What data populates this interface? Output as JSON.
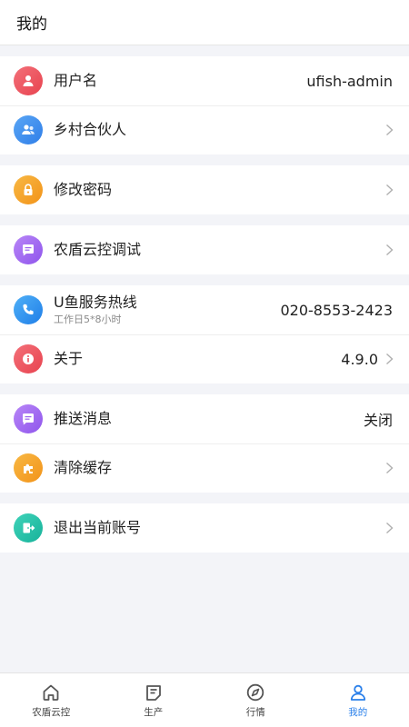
{
  "header": {
    "title": "我的"
  },
  "groups": [
    {
      "rows": [
        {
          "label": "用户名",
          "value": "ufish-admin",
          "icon": "user-icon",
          "color": "#ee5561"
        },
        {
          "label": "乡村合伙人",
          "icon": "partners-icon",
          "color": "#3f8ef0"
        }
      ]
    },
    {
      "rows": [
        {
          "label": "修改密码",
          "icon": "lock-icon",
          "color": "#f5a623"
        }
      ]
    },
    {
      "rows": [
        {
          "label": "农盾云控调试",
          "icon": "message-icon",
          "color": "#a76bf2"
        }
      ]
    },
    {
      "rows": [
        {
          "label": "U鱼服务热线",
          "sublabel": "工作日5*8小时",
          "value": "020-8553-2423",
          "icon": "phone-icon",
          "color": "#2f93f2"
        },
        {
          "label": "关于",
          "value": "4.9.0",
          "icon": "info-icon",
          "color": "#ee5561"
        }
      ]
    },
    {
      "rows": [
        {
          "label": "推送消息",
          "value": "关闭",
          "icon": "message-icon",
          "color": "#a76bf2"
        },
        {
          "label": "清除缓存",
          "icon": "puzzle-icon",
          "color": "#f5a623"
        }
      ]
    },
    {
      "rows": [
        {
          "label": "退出当前账号",
          "icon": "logout-icon",
          "color": "#22c2a7"
        }
      ]
    }
  ],
  "nav": {
    "items": [
      {
        "label": "农盾云控",
        "icon": "home-icon"
      },
      {
        "label": "生产",
        "icon": "production-icon"
      },
      {
        "label": "行情",
        "icon": "compass-icon"
      },
      {
        "label": "我的",
        "icon": "profile-icon",
        "active": true
      }
    ],
    "active_color": "#2b80ea"
  }
}
